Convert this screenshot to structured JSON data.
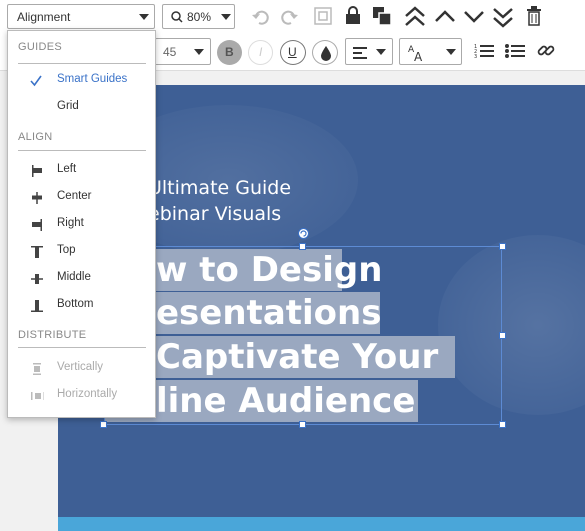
{
  "toolbar": {
    "alignment_label": "Alignment",
    "zoom_label": "80%",
    "font_size": "45"
  },
  "menu": {
    "guides_header": "GUIDES",
    "smart_guides": "Smart Guides",
    "grid": "Grid",
    "align_header": "ALIGN",
    "left": "Left",
    "center": "Center",
    "right": "Right",
    "top": "Top",
    "middle": "Middle",
    "bottom": "Bottom",
    "distribute_header": "DISTRIBUTE",
    "vertically": "Vertically",
    "horizontally": "Horizontally"
  },
  "slide": {
    "subtitle_line1": "Ultimate Guide",
    "subtitle_line2": "ebinar Visuals",
    "title_line1": "w to Design",
    "title_line2": "esentations",
    "title_line3": "Captivate Your",
    "title_line4": "line Audience"
  },
  "colors": {
    "slide_bg": "#3e5f95",
    "accent_blue": "#3a72c8",
    "bottom_bar": "#4aa6d9"
  }
}
